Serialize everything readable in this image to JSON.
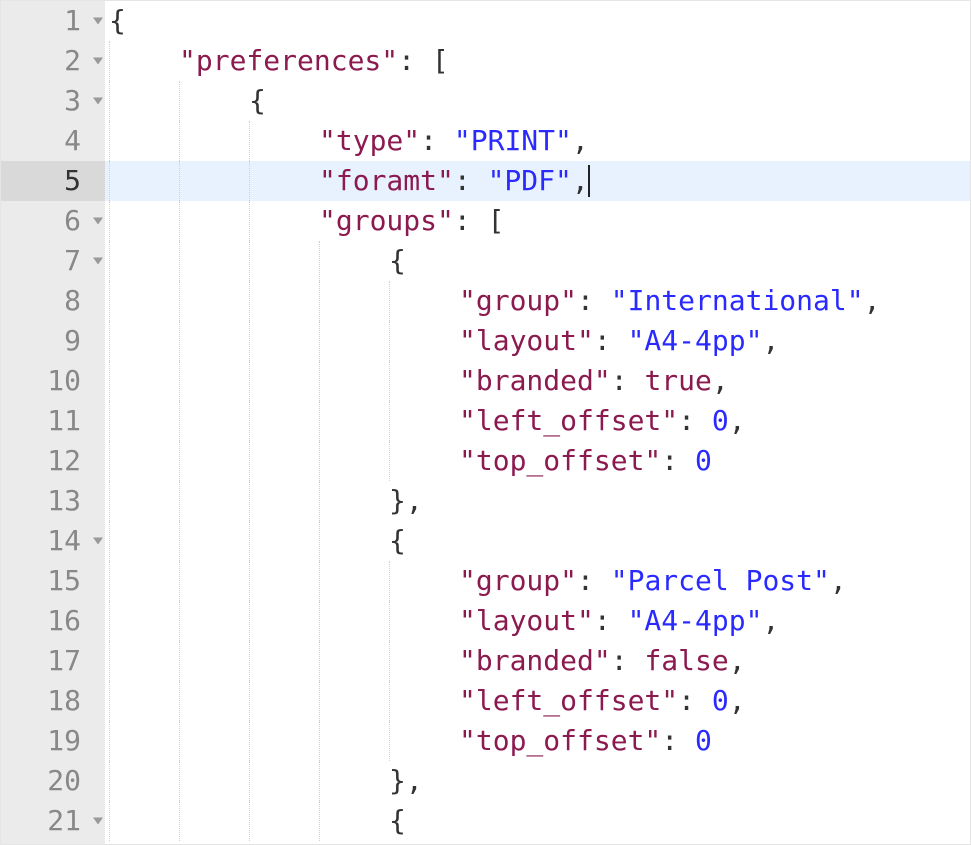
{
  "editor": {
    "active_line": 5,
    "cursor_line": 5,
    "cursor_after_token_index": 4,
    "lines": [
      {
        "n": 1,
        "fold": true,
        "indent": 0,
        "tokens": [
          {
            "t": "{",
            "c": "punct"
          }
        ]
      },
      {
        "n": 2,
        "fold": true,
        "indent": 1,
        "tokens": [
          {
            "t": "\"preferences\"",
            "c": "key"
          },
          {
            "t": ": ",
            "c": "punct"
          },
          {
            "t": "[",
            "c": "punct"
          }
        ]
      },
      {
        "n": 3,
        "fold": true,
        "indent": 2,
        "tokens": [
          {
            "t": "{",
            "c": "punct"
          }
        ]
      },
      {
        "n": 4,
        "fold": false,
        "indent": 3,
        "tokens": [
          {
            "t": "\"type\"",
            "c": "key"
          },
          {
            "t": ": ",
            "c": "punct"
          },
          {
            "t": "\"PRINT\"",
            "c": "string"
          },
          {
            "t": ",",
            "c": "punct"
          }
        ]
      },
      {
        "n": 5,
        "fold": false,
        "indent": 3,
        "tokens": [
          {
            "t": "\"foramt\"",
            "c": "key"
          },
          {
            "t": ": ",
            "c": "punct"
          },
          {
            "t": "\"PDF\"",
            "c": "string"
          },
          {
            "t": ",",
            "c": "punct"
          }
        ]
      },
      {
        "n": 6,
        "fold": true,
        "indent": 3,
        "tokens": [
          {
            "t": "\"groups\"",
            "c": "key"
          },
          {
            "t": ": ",
            "c": "punct"
          },
          {
            "t": "[",
            "c": "punct"
          }
        ]
      },
      {
        "n": 7,
        "fold": true,
        "indent": 4,
        "tokens": [
          {
            "t": "{",
            "c": "punct"
          }
        ]
      },
      {
        "n": 8,
        "fold": false,
        "indent": 5,
        "tokens": [
          {
            "t": "\"group\"",
            "c": "key"
          },
          {
            "t": ": ",
            "c": "punct"
          },
          {
            "t": "\"International\"",
            "c": "string"
          },
          {
            "t": ",",
            "c": "punct"
          }
        ]
      },
      {
        "n": 9,
        "fold": false,
        "indent": 5,
        "tokens": [
          {
            "t": "\"layout\"",
            "c": "key"
          },
          {
            "t": ": ",
            "c": "punct"
          },
          {
            "t": "\"A4-4pp\"",
            "c": "string"
          },
          {
            "t": ",",
            "c": "punct"
          }
        ]
      },
      {
        "n": 10,
        "fold": false,
        "indent": 5,
        "tokens": [
          {
            "t": "\"branded\"",
            "c": "key"
          },
          {
            "t": ": ",
            "c": "punct"
          },
          {
            "t": "true",
            "c": "boolean"
          },
          {
            "t": ",",
            "c": "punct"
          }
        ]
      },
      {
        "n": 11,
        "fold": false,
        "indent": 5,
        "tokens": [
          {
            "t": "\"left_offset\"",
            "c": "key"
          },
          {
            "t": ": ",
            "c": "punct"
          },
          {
            "t": "0",
            "c": "number"
          },
          {
            "t": ",",
            "c": "punct"
          }
        ]
      },
      {
        "n": 12,
        "fold": false,
        "indent": 5,
        "tokens": [
          {
            "t": "\"top_offset\"",
            "c": "key"
          },
          {
            "t": ": ",
            "c": "punct"
          },
          {
            "t": "0",
            "c": "number"
          }
        ]
      },
      {
        "n": 13,
        "fold": false,
        "indent": 4,
        "tokens": [
          {
            "t": "},",
            "c": "punct"
          }
        ]
      },
      {
        "n": 14,
        "fold": true,
        "indent": 4,
        "tokens": [
          {
            "t": "{",
            "c": "punct"
          }
        ]
      },
      {
        "n": 15,
        "fold": false,
        "indent": 5,
        "tokens": [
          {
            "t": "\"group\"",
            "c": "key"
          },
          {
            "t": ": ",
            "c": "punct"
          },
          {
            "t": "\"Parcel Post\"",
            "c": "string"
          },
          {
            "t": ",",
            "c": "punct"
          }
        ]
      },
      {
        "n": 16,
        "fold": false,
        "indent": 5,
        "tokens": [
          {
            "t": "\"layout\"",
            "c": "key"
          },
          {
            "t": ": ",
            "c": "punct"
          },
          {
            "t": "\"A4-4pp\"",
            "c": "string"
          },
          {
            "t": ",",
            "c": "punct"
          }
        ]
      },
      {
        "n": 17,
        "fold": false,
        "indent": 5,
        "tokens": [
          {
            "t": "\"branded\"",
            "c": "key"
          },
          {
            "t": ": ",
            "c": "punct"
          },
          {
            "t": "false",
            "c": "boolean"
          },
          {
            "t": ",",
            "c": "punct"
          }
        ]
      },
      {
        "n": 18,
        "fold": false,
        "indent": 5,
        "tokens": [
          {
            "t": "\"left_offset\"",
            "c": "key"
          },
          {
            "t": ": ",
            "c": "punct"
          },
          {
            "t": "0",
            "c": "number"
          },
          {
            "t": ",",
            "c": "punct"
          }
        ]
      },
      {
        "n": 19,
        "fold": false,
        "indent": 5,
        "tokens": [
          {
            "t": "\"top_offset\"",
            "c": "key"
          },
          {
            "t": ": ",
            "c": "punct"
          },
          {
            "t": "0",
            "c": "number"
          }
        ]
      },
      {
        "n": 20,
        "fold": false,
        "indent": 4,
        "tokens": [
          {
            "t": "},",
            "c": "punct"
          }
        ]
      },
      {
        "n": 21,
        "fold": true,
        "indent": 4,
        "tokens": [
          {
            "t": "{",
            "c": "punct"
          }
        ]
      }
    ]
  },
  "source_json": {
    "preferences": [
      {
        "type": "PRINT",
        "foramt": "PDF",
        "groups": [
          {
            "group": "International",
            "layout": "A4-4pp",
            "branded": true,
            "left_offset": 0,
            "top_offset": 0
          },
          {
            "group": "Parcel Post",
            "layout": "A4-4pp",
            "branded": false,
            "left_offset": 0,
            "top_offset": 0
          }
        ]
      }
    ]
  }
}
